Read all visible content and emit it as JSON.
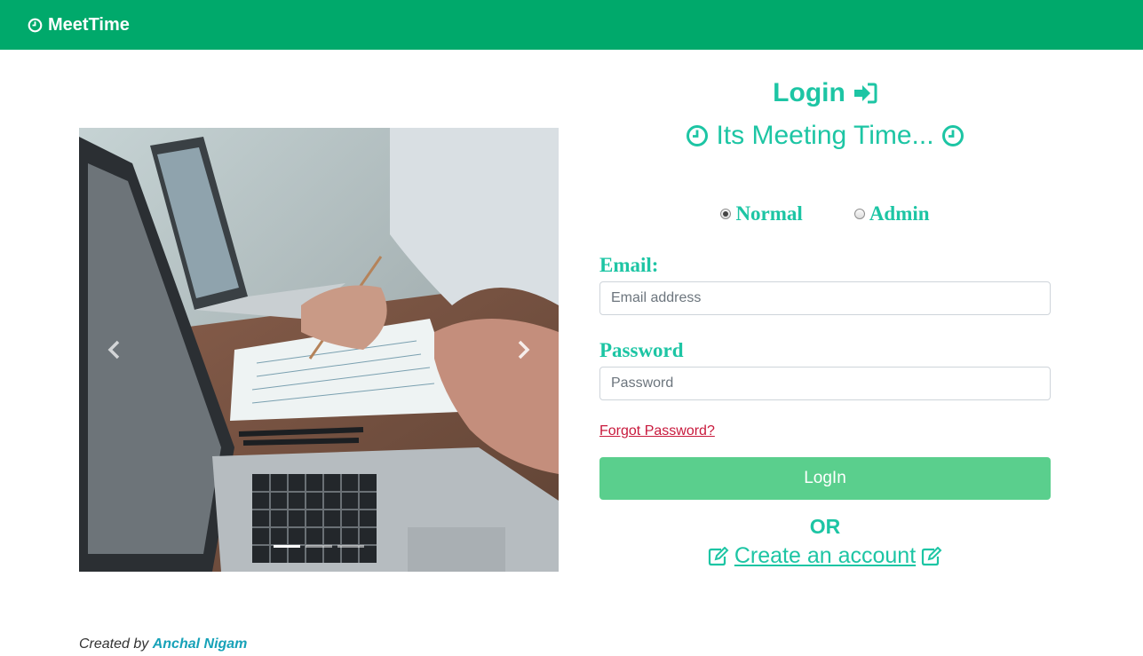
{
  "navbar": {
    "brand": "MeetTime",
    "brand_icon": "clock-icon",
    "bg_color": "#00a96b"
  },
  "carousel": {
    "slides": 3,
    "active_slide": 1,
    "prev_icon": "chevron-left-icon",
    "next_icon": "chevron-right-icon"
  },
  "login": {
    "title": "Login",
    "title_icon": "sign-in-icon",
    "tagline": "Its Meeting Time...",
    "tagline_icon": "clock-icon",
    "accent_color": "#1dc5a4",
    "role_options": [
      {
        "label": "Normal",
        "checked": true
      },
      {
        "label": "Admin",
        "checked": false
      }
    ],
    "email_label": "Email:",
    "email_placeholder": "Email address",
    "password_label": "Password",
    "password_placeholder": "Password",
    "forgot_link": "Forgot Password?",
    "login_button": "LogIn",
    "button_color": "#5acf8d",
    "or_text": "OR",
    "create_account": "Create an account",
    "create_icon": "edit-icon"
  },
  "footer": {
    "created_by": "Created by",
    "author": "Anchal Nigam"
  }
}
